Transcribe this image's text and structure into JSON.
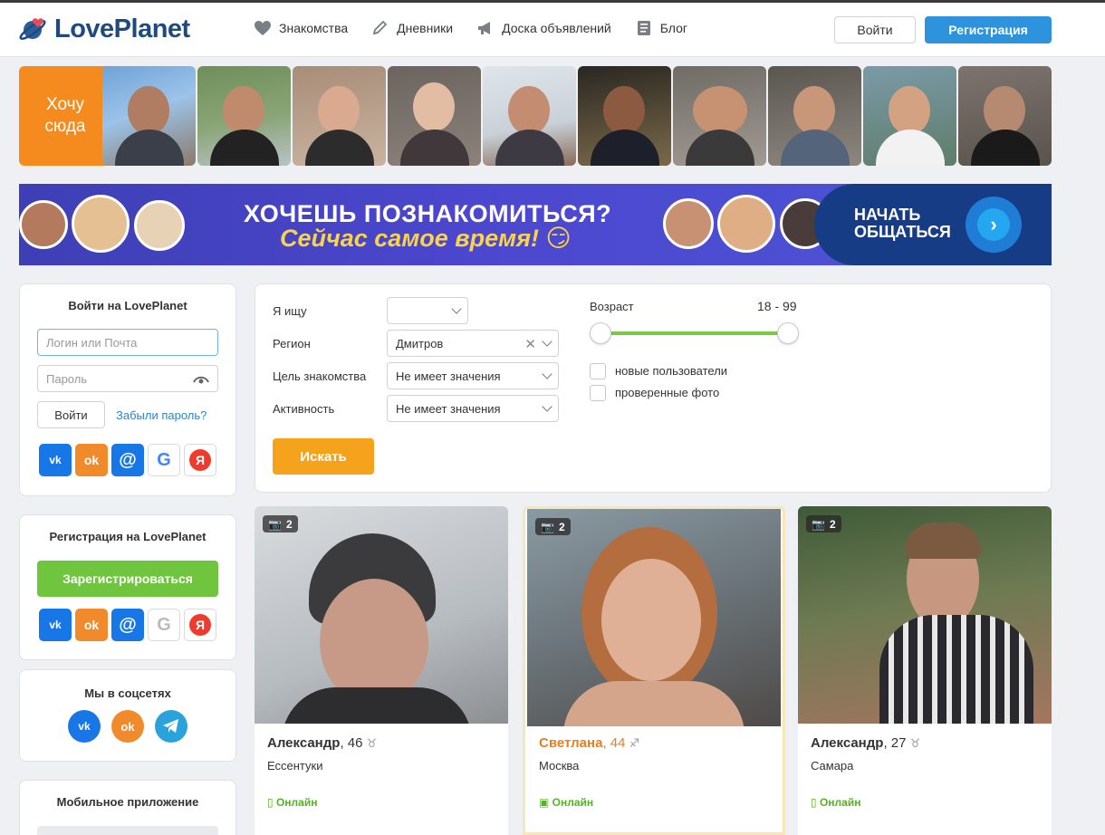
{
  "header": {
    "logo_text": "LovePlanet",
    "nav": [
      {
        "label": "Знакомства",
        "icon": "heart-icon"
      },
      {
        "label": "Дневники",
        "icon": "pencil-icon"
      },
      {
        "label": "Доска объявлений",
        "icon": "megaphone-icon"
      },
      {
        "label": "Блог",
        "icon": "notebook-icon"
      }
    ],
    "login_label": "Войти",
    "register_label": "Регистрация"
  },
  "strip": {
    "want_here": "Хочу сюда"
  },
  "banner": {
    "title": "ХОЧЕШЬ ПОЗНАКОМИТЬСЯ?",
    "subtitle": "Сейчас самое время! 😏",
    "cta": "НАЧАТЬ ОБЩАТЬСЯ"
  },
  "login_card": {
    "title": "Войти на LovePlanet",
    "login_placeholder": "Логин или Почта",
    "password_placeholder": "Пароль",
    "submit": "Войти",
    "forgot": "Забыли пароль?"
  },
  "register_card": {
    "title": "Регистрация на LovePlanet",
    "button": "Зарегистрироваться"
  },
  "social_card": {
    "title": "Мы в соцсетях"
  },
  "app_card": {
    "title": "Мобильное приложение"
  },
  "filter": {
    "looking_for_label": "Я ищу",
    "looking_for_value": "",
    "region_label": "Регион",
    "region_value": "Дмитров",
    "goal_label": "Цель знакомства",
    "goal_value": "Не имеет значения",
    "activity_label": "Активность",
    "activity_value": "Не имеет значения",
    "search_button": "Искать",
    "age_label": "Возраст",
    "age_range": "18 - 99",
    "new_users_label": "новые пользователи",
    "verified_label": "проверенные фото"
  },
  "profiles": [
    {
      "name": "Александр",
      "age": ", 46",
      "zodiac": "♉",
      "city": "Ессентуки",
      "status": "Онлайн",
      "photos": "2"
    },
    {
      "name": "Светлана",
      "age": ", 44",
      "zodiac": "♐",
      "city": "Москва",
      "status": "Онлайн",
      "photos": "2"
    },
    {
      "name": "Александр",
      "age": ", 27",
      "zodiac": "♉",
      "city": "Самара",
      "status": "Онлайн",
      "photos": "2"
    }
  ],
  "colors": {
    "brand_blue": "#1f4a7d",
    "accent_blue": "#2d93dc",
    "orange": "#f58a1f",
    "green": "#7bc943",
    "online_green": "#56b02a"
  }
}
